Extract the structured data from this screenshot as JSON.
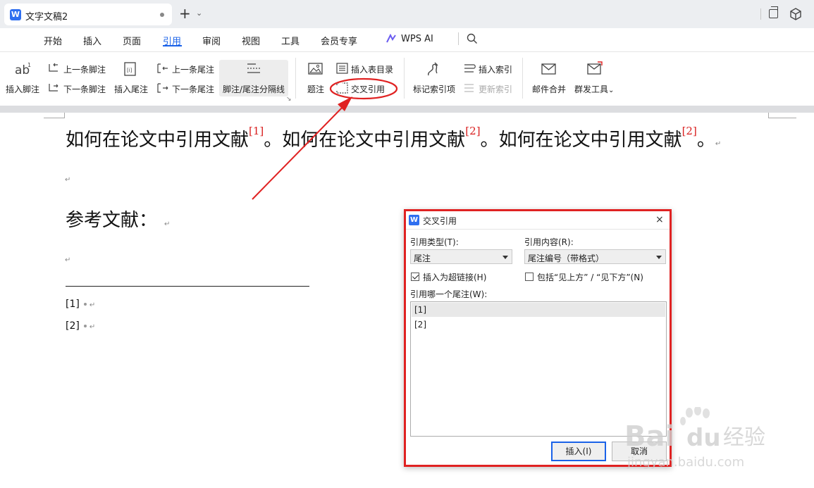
{
  "titlebar": {
    "doc_title": "文字文稿2",
    "logo_letter": "W",
    "new_tab": "+",
    "new_tab_caret": "⌄"
  },
  "menu": {
    "items": [
      "开始",
      "插入",
      "页面",
      "引用",
      "审阅",
      "视图",
      "工具",
      "会员专享",
      "WPS AI"
    ],
    "active": "引用"
  },
  "ribbon": {
    "insert_footnote": "插入脚注",
    "prev_footnote": "上一条脚注",
    "next_footnote": "下一条脚注",
    "insert_endnote": "插入尾注",
    "prev_endnote": "上一条尾注",
    "next_endnote": "下一条尾注",
    "separator": "脚注/尾注分隔线",
    "caption": "题注",
    "insert_toc_table": "插入表目录",
    "cross_ref": "交叉引用",
    "mark_index": "标记索引项",
    "insert_index": "插入索引",
    "update_index": "更新索引",
    "mail_merge": "邮件合并",
    "mass_tool": "群发工具",
    "mass_tool_caret": "⌄",
    "expand_arrow": "↘"
  },
  "document": {
    "sentence": "如何在论文中引用文献",
    "period": "。",
    "refs": [
      "[1]",
      "[2]",
      "[2]"
    ],
    "para_mark": "↵",
    "ref_heading": "参考文献：",
    "endnotes": [
      "[1]",
      "[2]"
    ]
  },
  "dialog": {
    "logo_letter": "W",
    "title": "交叉引用",
    "close": "×",
    "ref_type_label": "引用类型(T):",
    "ref_type_value": "尾注",
    "ref_content_label": "引用内容(R):",
    "ref_content_value": "尾注编号（带格式）",
    "hyperlink_label": "插入为超链接(H)",
    "hyperlink_checked": true,
    "include_label": "包括“见上方” / “见下方”(N)",
    "include_checked": false,
    "which_label": "引用哪一个尾注(W):",
    "list": [
      "[1]",
      "[2]"
    ],
    "selected_index": 0,
    "insert_btn": "插入(I)",
    "cancel_btn": "取消"
  },
  "watermark": {
    "brand": "Bai",
    "brand2": "du",
    "suffix": "经验",
    "url": "jingyan.baidu.com"
  },
  "colors": {
    "accent": "#1a62e8",
    "annotation": "#e02222",
    "citation": "#d92020"
  }
}
